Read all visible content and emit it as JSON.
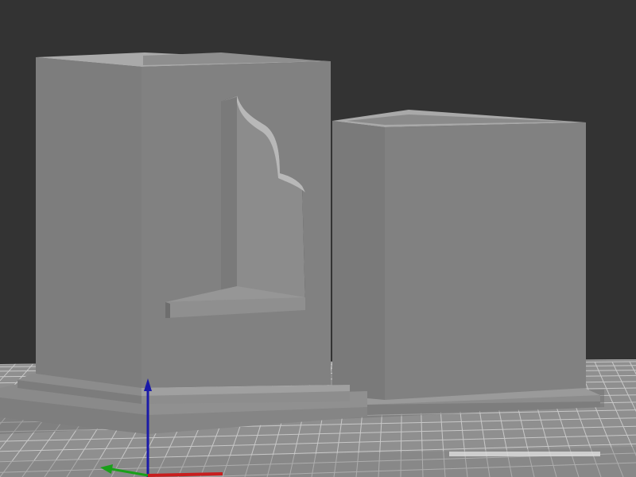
{
  "viewport": {
    "background": "#333333",
    "bed_color": "#8f8f8f",
    "grid_color": "#c8c8c8"
  },
  "scene": {
    "objects": [
      {
        "name": "left-box-with-arched-niche",
        "color": "#7f7f7f"
      },
      {
        "name": "right-plain-box",
        "color": "#7f7f7f"
      }
    ]
  },
  "axes": {
    "z_color": "#1a1aa8",
    "y_color": "#19a019",
    "x_color": "#c81e1e"
  }
}
